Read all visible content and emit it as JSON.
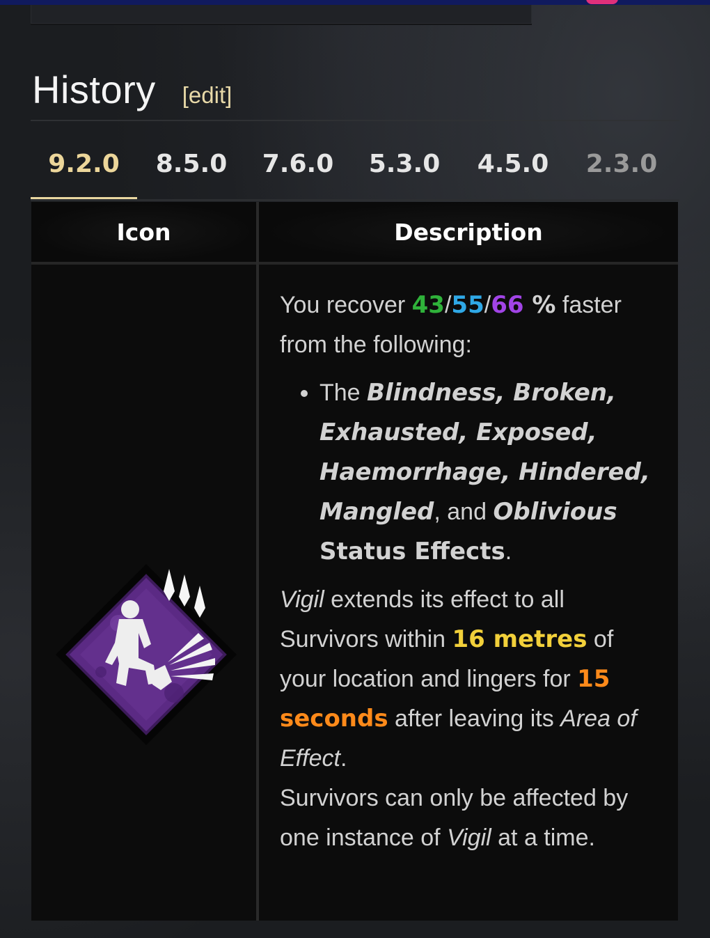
{
  "heading": {
    "title": "History",
    "edit_label": "[edit]"
  },
  "tabs": [
    {
      "label": "9.2.0",
      "active": true
    },
    {
      "label": "8.5.0",
      "active": false
    },
    {
      "label": "7.6.0",
      "active": false
    },
    {
      "label": "5.3.0",
      "active": false
    },
    {
      "label": "4.5.0",
      "active": false
    },
    {
      "label": "2.3.0",
      "active": false
    }
  ],
  "table": {
    "headers": {
      "icon": "Icon",
      "description": "Description"
    },
    "row": {
      "icon_name": "vigil-perk-icon",
      "description": {
        "p1": {
          "lead": "You recover ",
          "v1": "43",
          "sep1": "/",
          "v2": "55",
          "sep2": "/",
          "v3": "66",
          "pct": " %",
          "tail": " faster from the following:"
        },
        "bullet": {
          "lead": "The ",
          "effects": "Blindness, Broken, Exhausted, Exposed, Haemorrhage, Hindered, Mangled",
          "and": ", and ",
          "last_effect": "Oblivious",
          "status": " Status Effects",
          "end": "."
        },
        "p2": {
          "perk": "Vigil",
          "a": " extends its effect to all Survivors within ",
          "range": "16 metres",
          "b": " of your location and lingers for ",
          "duration": "15 seconds",
          "c": " after leaving its ",
          "aoe": "Area of Effect",
          "d": "."
        },
        "p3": {
          "a": "Survivors can only be affected by one instance of ",
          "perk": "Vigil",
          "b": " at a time."
        }
      }
    }
  },
  "colors": {
    "rarity_common": "#2fb23a",
    "rarity_rare": "#2fa8e6",
    "rarity_veryrare": "#a144e6",
    "highlight_yellow": "#f2d03a",
    "highlight_orange": "#ff8a1a",
    "tab_active": "#ecd69a",
    "perk_purple": "#5b2a84"
  }
}
